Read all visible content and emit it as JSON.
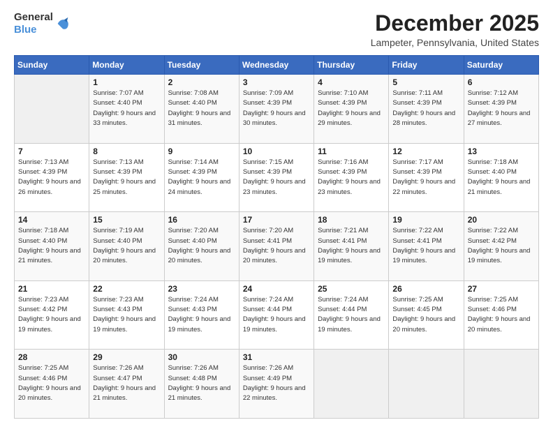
{
  "header": {
    "logo_general": "General",
    "logo_blue": "Blue",
    "month_title": "December 2025",
    "location": "Lampeter, Pennsylvania, United States"
  },
  "calendar": {
    "days_of_week": [
      "Sunday",
      "Monday",
      "Tuesday",
      "Wednesday",
      "Thursday",
      "Friday",
      "Saturday"
    ],
    "weeks": [
      [
        {
          "day": "",
          "sunrise": "",
          "sunset": "",
          "daylight": "",
          "empty": true
        },
        {
          "day": "1",
          "sunrise": "Sunrise: 7:07 AM",
          "sunset": "Sunset: 4:40 PM",
          "daylight": "Daylight: 9 hours and 33 minutes.",
          "empty": false
        },
        {
          "day": "2",
          "sunrise": "Sunrise: 7:08 AM",
          "sunset": "Sunset: 4:40 PM",
          "daylight": "Daylight: 9 hours and 31 minutes.",
          "empty": false
        },
        {
          "day": "3",
          "sunrise": "Sunrise: 7:09 AM",
          "sunset": "Sunset: 4:39 PM",
          "daylight": "Daylight: 9 hours and 30 minutes.",
          "empty": false
        },
        {
          "day": "4",
          "sunrise": "Sunrise: 7:10 AM",
          "sunset": "Sunset: 4:39 PM",
          "daylight": "Daylight: 9 hours and 29 minutes.",
          "empty": false
        },
        {
          "day": "5",
          "sunrise": "Sunrise: 7:11 AM",
          "sunset": "Sunset: 4:39 PM",
          "daylight": "Daylight: 9 hours and 28 minutes.",
          "empty": false
        },
        {
          "day": "6",
          "sunrise": "Sunrise: 7:12 AM",
          "sunset": "Sunset: 4:39 PM",
          "daylight": "Daylight: 9 hours and 27 minutes.",
          "empty": false
        }
      ],
      [
        {
          "day": "7",
          "sunrise": "Sunrise: 7:13 AM",
          "sunset": "Sunset: 4:39 PM",
          "daylight": "Daylight: 9 hours and 26 minutes.",
          "empty": false
        },
        {
          "day": "8",
          "sunrise": "Sunrise: 7:13 AM",
          "sunset": "Sunset: 4:39 PM",
          "daylight": "Daylight: 9 hours and 25 minutes.",
          "empty": false
        },
        {
          "day": "9",
          "sunrise": "Sunrise: 7:14 AM",
          "sunset": "Sunset: 4:39 PM",
          "daylight": "Daylight: 9 hours and 24 minutes.",
          "empty": false
        },
        {
          "day": "10",
          "sunrise": "Sunrise: 7:15 AM",
          "sunset": "Sunset: 4:39 PM",
          "daylight": "Daylight: 9 hours and 23 minutes.",
          "empty": false
        },
        {
          "day": "11",
          "sunrise": "Sunrise: 7:16 AM",
          "sunset": "Sunset: 4:39 PM",
          "daylight": "Daylight: 9 hours and 23 minutes.",
          "empty": false
        },
        {
          "day": "12",
          "sunrise": "Sunrise: 7:17 AM",
          "sunset": "Sunset: 4:39 PM",
          "daylight": "Daylight: 9 hours and 22 minutes.",
          "empty": false
        },
        {
          "day": "13",
          "sunrise": "Sunrise: 7:18 AM",
          "sunset": "Sunset: 4:40 PM",
          "daylight": "Daylight: 9 hours and 21 minutes.",
          "empty": false
        }
      ],
      [
        {
          "day": "14",
          "sunrise": "Sunrise: 7:18 AM",
          "sunset": "Sunset: 4:40 PM",
          "daylight": "Daylight: 9 hours and 21 minutes.",
          "empty": false
        },
        {
          "day": "15",
          "sunrise": "Sunrise: 7:19 AM",
          "sunset": "Sunset: 4:40 PM",
          "daylight": "Daylight: 9 hours and 20 minutes.",
          "empty": false
        },
        {
          "day": "16",
          "sunrise": "Sunrise: 7:20 AM",
          "sunset": "Sunset: 4:40 PM",
          "daylight": "Daylight: 9 hours and 20 minutes.",
          "empty": false
        },
        {
          "day": "17",
          "sunrise": "Sunrise: 7:20 AM",
          "sunset": "Sunset: 4:41 PM",
          "daylight": "Daylight: 9 hours and 20 minutes.",
          "empty": false
        },
        {
          "day": "18",
          "sunrise": "Sunrise: 7:21 AM",
          "sunset": "Sunset: 4:41 PM",
          "daylight": "Daylight: 9 hours and 19 minutes.",
          "empty": false
        },
        {
          "day": "19",
          "sunrise": "Sunrise: 7:22 AM",
          "sunset": "Sunset: 4:41 PM",
          "daylight": "Daylight: 9 hours and 19 minutes.",
          "empty": false
        },
        {
          "day": "20",
          "sunrise": "Sunrise: 7:22 AM",
          "sunset": "Sunset: 4:42 PM",
          "daylight": "Daylight: 9 hours and 19 minutes.",
          "empty": false
        }
      ],
      [
        {
          "day": "21",
          "sunrise": "Sunrise: 7:23 AM",
          "sunset": "Sunset: 4:42 PM",
          "daylight": "Daylight: 9 hours and 19 minutes.",
          "empty": false
        },
        {
          "day": "22",
          "sunrise": "Sunrise: 7:23 AM",
          "sunset": "Sunset: 4:43 PM",
          "daylight": "Daylight: 9 hours and 19 minutes.",
          "empty": false
        },
        {
          "day": "23",
          "sunrise": "Sunrise: 7:24 AM",
          "sunset": "Sunset: 4:43 PM",
          "daylight": "Daylight: 9 hours and 19 minutes.",
          "empty": false
        },
        {
          "day": "24",
          "sunrise": "Sunrise: 7:24 AM",
          "sunset": "Sunset: 4:44 PM",
          "daylight": "Daylight: 9 hours and 19 minutes.",
          "empty": false
        },
        {
          "day": "25",
          "sunrise": "Sunrise: 7:24 AM",
          "sunset": "Sunset: 4:44 PM",
          "daylight": "Daylight: 9 hours and 19 minutes.",
          "empty": false
        },
        {
          "day": "26",
          "sunrise": "Sunrise: 7:25 AM",
          "sunset": "Sunset: 4:45 PM",
          "daylight": "Daylight: 9 hours and 20 minutes.",
          "empty": false
        },
        {
          "day": "27",
          "sunrise": "Sunrise: 7:25 AM",
          "sunset": "Sunset: 4:46 PM",
          "daylight": "Daylight: 9 hours and 20 minutes.",
          "empty": false
        }
      ],
      [
        {
          "day": "28",
          "sunrise": "Sunrise: 7:25 AM",
          "sunset": "Sunset: 4:46 PM",
          "daylight": "Daylight: 9 hours and 20 minutes.",
          "empty": false
        },
        {
          "day": "29",
          "sunrise": "Sunrise: 7:26 AM",
          "sunset": "Sunset: 4:47 PM",
          "daylight": "Daylight: 9 hours and 21 minutes.",
          "empty": false
        },
        {
          "day": "30",
          "sunrise": "Sunrise: 7:26 AM",
          "sunset": "Sunset: 4:48 PM",
          "daylight": "Daylight: 9 hours and 21 minutes.",
          "empty": false
        },
        {
          "day": "31",
          "sunrise": "Sunrise: 7:26 AM",
          "sunset": "Sunset: 4:49 PM",
          "daylight": "Daylight: 9 hours and 22 minutes.",
          "empty": false
        },
        {
          "day": "",
          "sunrise": "",
          "sunset": "",
          "daylight": "",
          "empty": true
        },
        {
          "day": "",
          "sunrise": "",
          "sunset": "",
          "daylight": "",
          "empty": true
        },
        {
          "day": "",
          "sunrise": "",
          "sunset": "",
          "daylight": "",
          "empty": true
        }
      ]
    ]
  }
}
